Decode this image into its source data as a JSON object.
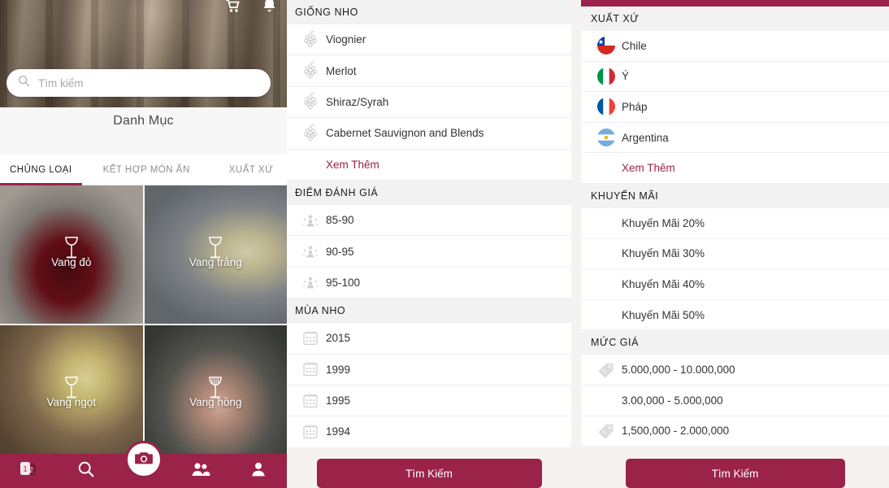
{
  "app": {
    "search": {
      "placeholder": "Tìm kiếm",
      "icon": "search-icon",
      "value": ""
    },
    "title": "Danh Mục",
    "header_icons": [
      {
        "name": "cart-icon"
      },
      {
        "name": "bell-icon"
      }
    ],
    "tabs": [
      {
        "label": "CHỦNG LOẠI",
        "active": true
      },
      {
        "label": "KẾT HỢP MÓN ĂN",
        "active": false
      },
      {
        "label": "XUẤT XỨ",
        "active": false
      }
    ],
    "categories": [
      {
        "label": "Vang đỏ",
        "icon": "wine-glass-icon"
      },
      {
        "label": "Vang trắng",
        "icon": "wine-glass-icon"
      },
      {
        "label": "Vang ngọt",
        "icon": "wine-glass-icon"
      },
      {
        "label": "Vang hồng",
        "icon": "wine-glass-icon"
      }
    ],
    "bottom_nav": [
      {
        "name": "cards-icon",
        "badge": "1"
      },
      {
        "name": "search-icon"
      },
      {
        "name": "camera-icon"
      },
      {
        "name": "people-icon"
      },
      {
        "name": "person-icon"
      }
    ]
  },
  "middle_column": {
    "sections": [
      {
        "header": "GIỐNG NHO",
        "rows": [
          {
            "label": "Viognier",
            "icon": "grape-icon"
          },
          {
            "label": "Merlot",
            "icon": "grape-icon"
          },
          {
            "label": "Shiraz/Syrah",
            "icon": "grape-icon"
          },
          {
            "label": "Cabernet Sauvignon and Blends",
            "icon": "grape-icon"
          }
        ],
        "more": "Xem Thêm"
      },
      {
        "header": "ĐIỂM ĐÁNH GIÁ",
        "rows": [
          {
            "label": "85-90",
            "icon": "award-icon"
          },
          {
            "label": "90-95",
            "icon": "award-icon"
          },
          {
            "label": "95-100",
            "icon": "award-icon"
          }
        ]
      },
      {
        "header": "MÙA NHO",
        "rows": [
          {
            "label": "2015",
            "icon": "calendar-icon"
          },
          {
            "label": "1999",
            "icon": "calendar-icon"
          },
          {
            "label": "1995",
            "icon": "calendar-icon"
          },
          {
            "label": "1994",
            "icon": "calendar-icon"
          }
        ]
      }
    ],
    "search_button": "Tìm Kiếm"
  },
  "right_column": {
    "sections": [
      {
        "header": "XUẤT XỨ",
        "rows": [
          {
            "label": "Chile",
            "icon": "flag-chile-icon"
          },
          {
            "label": "Ý",
            "icon": "flag-italy-icon"
          },
          {
            "label": "Pháp",
            "icon": "flag-france-icon"
          },
          {
            "label": "Argentina",
            "icon": "flag-argentina-icon"
          }
        ],
        "more": "Xem Thêm"
      },
      {
        "header": "KHUYẾN MÃI",
        "rows": [
          {
            "label": "Khuyến Mãi 20%",
            "icon": ""
          },
          {
            "label": "Khuyến Mãi 30%",
            "icon": ""
          },
          {
            "label": "Khuyến Mãi 40%",
            "icon": ""
          },
          {
            "label": "Khuyến Mãi 50%",
            "icon": ""
          }
        ]
      },
      {
        "header": "MỨC GIÁ",
        "rows": [
          {
            "label": "5.000,000 - 10.000,000",
            "icon": "price-tag-icon"
          },
          {
            "label": "3.00,000 - 5.000,000",
            "icon": ""
          },
          {
            "label": "1,500,000 - 2.000,000",
            "icon": "price-tag-icon"
          }
        ]
      }
    ],
    "search_button": "Tìm Kiếm"
  },
  "colors": {
    "brand": "#9b2248",
    "page_bg": "#f6f2f0",
    "section_header_bg": "#f2f2f2",
    "row_bg": "#ffffff",
    "text": "#333333"
  }
}
